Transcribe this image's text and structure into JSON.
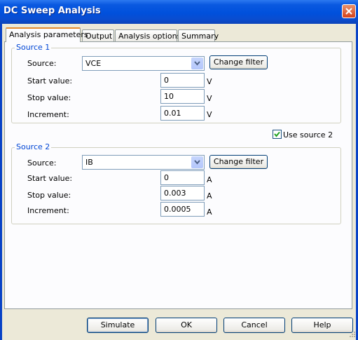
{
  "window": {
    "title": "DC Sweep Analysis"
  },
  "tabs": [
    "Analysis parameters",
    "Output",
    "Analysis options",
    "Summary"
  ],
  "source1": {
    "group_label": "Source 1",
    "source_label": "Source:",
    "source_value": "VCE",
    "change_filter": "Change filter",
    "start_label": "Start value:",
    "start_value": "0",
    "start_unit": "V",
    "stop_label": "Stop value:",
    "stop_value": "10",
    "stop_unit": "V",
    "increment_label": "Increment:",
    "increment_value": "0.01",
    "increment_unit": "V"
  },
  "use_source2": {
    "label": "Use source 2",
    "checked": true
  },
  "source2": {
    "group_label": "Source 2",
    "source_label": "Source:",
    "source_value": "IB",
    "change_filter": "Change filter",
    "start_label": "Start value:",
    "start_value": "0",
    "start_unit": "A",
    "stop_label": "Stop value:",
    "stop_value": "0.003",
    "stop_unit": "A",
    "increment_label": "Increment:",
    "increment_value": "0.0005",
    "increment_unit": "A"
  },
  "buttons": {
    "simulate": "Simulate",
    "ok": "OK",
    "cancel": "Cancel",
    "help": "Help"
  },
  "icons": {
    "close": "close-icon",
    "dropdown": "chevron-down-icon",
    "check": "checkmark-icon",
    "grip": "resize-grip-icon"
  },
  "colors": {
    "titlebar": "#0050dc",
    "group_label": "#0046d5",
    "active_tab": "#e68b2c"
  }
}
